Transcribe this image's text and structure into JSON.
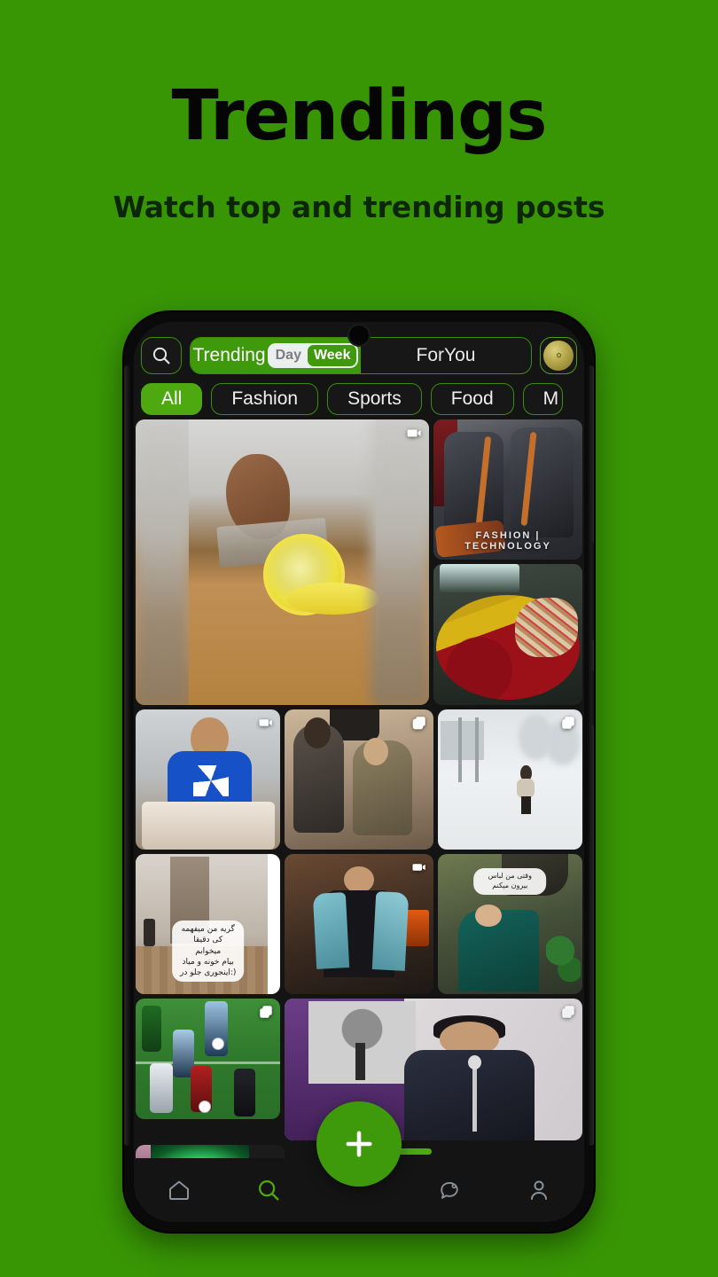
{
  "promo": {
    "title": "Trendings",
    "subtitle": "Watch top and trending posts"
  },
  "colors": {
    "background_green": "#389605",
    "accent_green": "#3f9a0b",
    "chip_active_green": "#4ea80f",
    "phone_frame": "#0a0a0a",
    "app_background": "#141414",
    "text_light": "#f0f0f0"
  },
  "app": {
    "topbar": {
      "search_icon": "search-icon",
      "tabs": [
        {
          "label": "Trending",
          "active": true
        },
        {
          "label": "ForYou",
          "active": false
        }
      ],
      "period_toggle": {
        "options": [
          "Day",
          "Week"
        ],
        "selected": "Week"
      },
      "avatar_icon": "avatar-icon"
    },
    "categories": [
      {
        "label": "All",
        "active": true
      },
      {
        "label": "Fashion",
        "active": false
      },
      {
        "label": "Sports",
        "active": false
      },
      {
        "label": "Food",
        "active": false
      },
      {
        "label": "M",
        "active": false,
        "truncated": true
      }
    ],
    "feed": {
      "rows": [
        {
          "items": [
            {
              "name": "post-lemon-video",
              "badge": "video-icon",
              "caption": ""
            },
            {
              "name": "post-car-interior",
              "badge": "",
              "watermark": "FASHION | TECHNOLOGY"
            },
            {
              "name": "post-rose-bouquet",
              "badge": "",
              "caption": ""
            }
          ]
        },
        {
          "items": [
            {
              "name": "post-man-blue-shirt-food",
              "badge": "video-icon"
            },
            {
              "name": "post-two-men-sitting",
              "badge": "carousel-icon"
            },
            {
              "name": "post-snowy-street",
              "badge": "carousel-icon"
            }
          ]
        },
        {
          "items": [
            {
              "name": "post-room-interior",
              "badge": "",
              "caption": "گریه من میفهمه کی دقیقا میخوابم\nبیام خونه و میاد اینجوری جلو در:)"
            },
            {
              "name": "post-man-denim-jacket",
              "badge": "video-icon"
            },
            {
              "name": "post-green-outfit",
              "badge": "",
              "caption": "وقتی من لباس بیرون میکنم"
            }
          ]
        },
        {
          "items": [
            {
              "name": "post-football-match",
              "badge": "carousel-icon"
            },
            {
              "name": "post-singer-stage",
              "badge": "carousel-icon"
            }
          ]
        },
        {
          "items": [
            {
              "name": "post-green-flash",
              "badge": "carousel-icon"
            }
          ]
        }
      ]
    },
    "fab": {
      "label": "+",
      "icon": "plus-icon"
    },
    "navbar": {
      "items": [
        {
          "icon": "home-icon",
          "label": "Home",
          "active": false
        },
        {
          "icon": "search-icon",
          "label": "Search",
          "active": true
        },
        {
          "icon": "chat-icon",
          "label": "Chat",
          "active": false
        },
        {
          "icon": "profile-icon",
          "label": "Profile",
          "active": false
        }
      ]
    }
  }
}
